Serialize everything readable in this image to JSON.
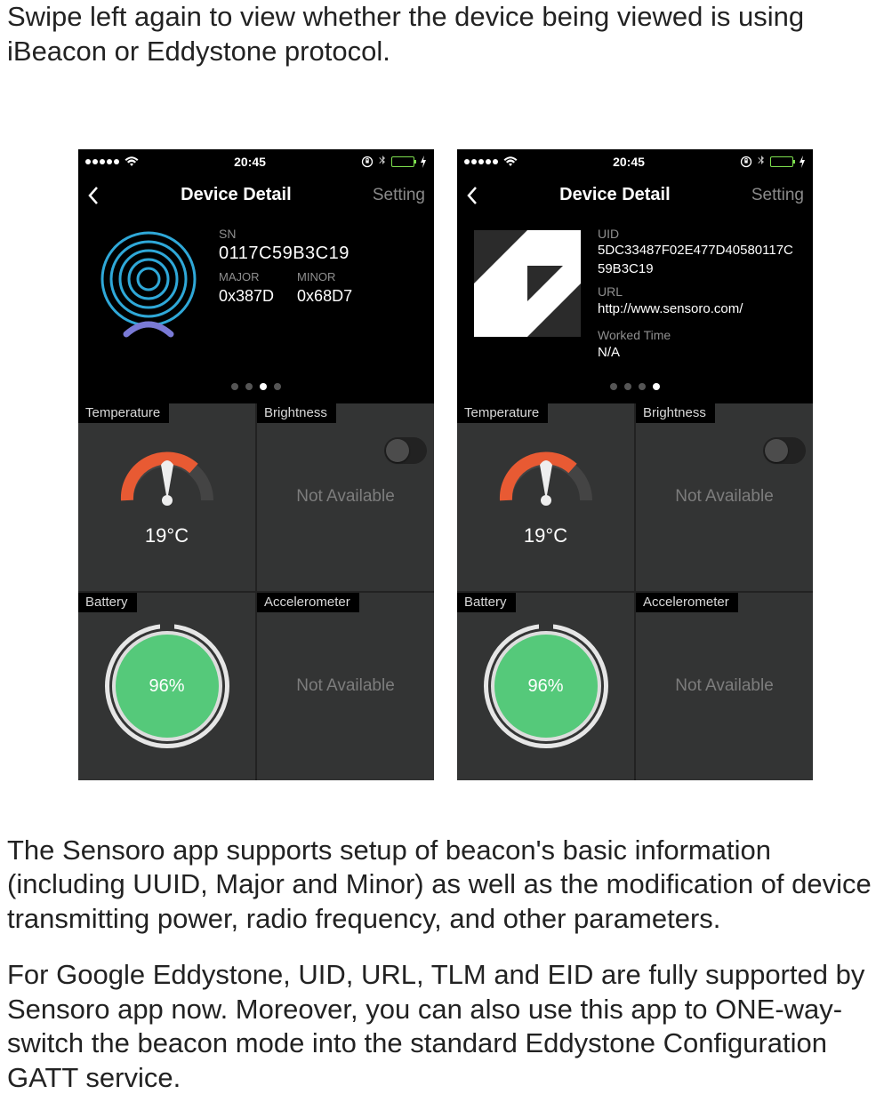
{
  "paragraphs": {
    "intro": "Swipe left again to view whether the device being viewed is using iBeacon or Eddystone protocol.",
    "p2": "The Sensoro app supports setup of beacon's basic information (including UUID, Major and Minor) as well as the modification of device transmitting power, radio frequency, and other parameters.",
    "p3": "For Google Eddystone, UID, URL, TLM and EID are fully supported by Sensoro app now. Moreover, you can also use this app to ONE-way-switch the beacon mode into the standard Eddystone Configuration GATT service."
  },
  "phone_common": {
    "clock": "20:45",
    "nav_title": "Device Detail",
    "nav_setting": "Setting"
  },
  "ibeacon": {
    "sn_label": "SN",
    "sn_value": "0117C59B3C19",
    "major_label": "MAJOR",
    "minor_label": "MINOR",
    "major_value": "0x387D",
    "minor_value": "0x68D7"
  },
  "eddystone": {
    "uid_label": "UID",
    "uid_value": "5DC33487F02E477D40580117C59B3C19",
    "url_label": "URL",
    "url_value": "http://www.sensoro.com/",
    "wt_label": "Worked Time",
    "wt_value": "N/A"
  },
  "sensors": {
    "temperature_label": "Temperature",
    "temperature_value": "19°C",
    "brightness_label": "Brightness",
    "brightness_value": "Not Available",
    "battery_label": "Battery",
    "battery_value": "96%",
    "accel_label": "Accelerometer",
    "accel_value": "Not Available"
  },
  "pagedots": {
    "left_active_index": 2,
    "right_active_index": 3,
    "count": 4
  },
  "icons": {
    "wifi": "wifi-icon",
    "bluetooth": "bluetooth-icon",
    "rotation_lock": "rotation-lock-icon",
    "bolt": "bolt-icon",
    "back": "chevron-left-icon",
    "beacon": "beacon-rings-icon",
    "eddystone": "eddystone-logo-icon"
  }
}
